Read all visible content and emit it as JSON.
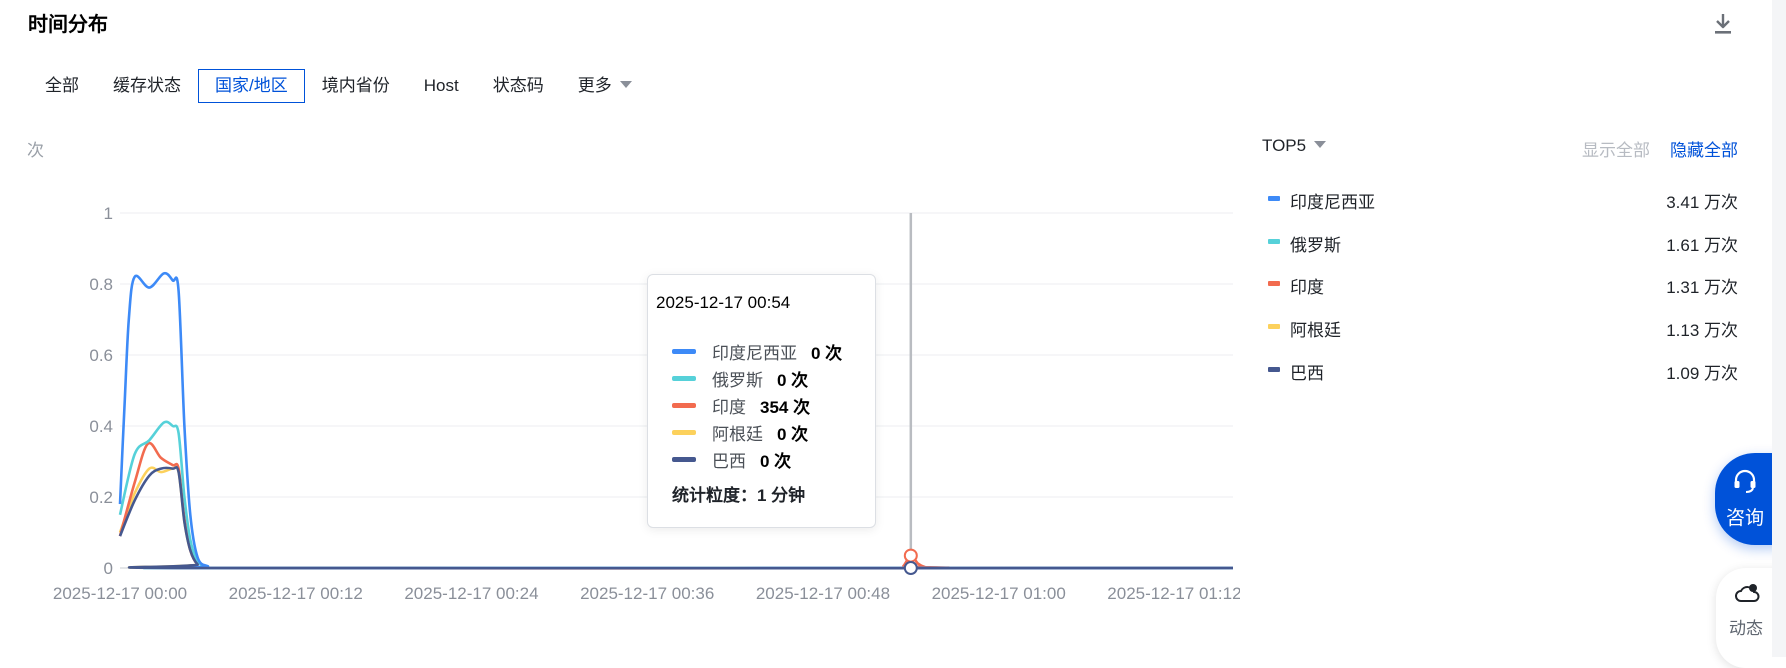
{
  "header": {
    "title": "时间分布",
    "download_icon": "download-icon"
  },
  "tabs": [
    {
      "label": "全部",
      "active": false
    },
    {
      "label": "缓存状态",
      "active": false
    },
    {
      "label": "国家/地区",
      "active": true
    },
    {
      "label": "境内省份",
      "active": false
    },
    {
      "label": "Host",
      "active": false
    },
    {
      "label": "状态码",
      "active": false
    },
    {
      "label": "更多",
      "active": false,
      "dropdown": true
    }
  ],
  "chart_data": {
    "type": "line",
    "ylabel": "次",
    "ylim": [
      0,
      1
    ],
    "yticks": [
      "0",
      "0.2",
      "0.4",
      "0.6",
      "0.8",
      "1"
    ],
    "xlim": [
      0,
      76
    ],
    "xtick_minutes": [
      0,
      12,
      24,
      36,
      48,
      60,
      72
    ],
    "xticks": [
      "2025-12-17 00:00",
      "2025-12-17 00:12",
      "2025-12-17 00:24",
      "2025-12-17 00:36",
      "2025-12-17 00:48",
      "2025-12-17 01:00",
      "2025-12-17 01:12"
    ],
    "grid": true,
    "cursor_minute": 54,
    "series": [
      {
        "name": "印度尼西亚",
        "color": "#3d8af7",
        "points": [
          [
            0,
            0.18
          ],
          [
            0.3,
            0.45
          ],
          [
            0.6,
            0.7
          ],
          [
            1,
            0.82
          ],
          [
            2,
            0.79
          ],
          [
            3,
            0.83
          ],
          [
            3.6,
            0.81
          ],
          [
            4,
            0.78
          ],
          [
            4.4,
            0.4
          ],
          [
            4.8,
            0.15
          ],
          [
            5.3,
            0.03
          ],
          [
            6,
            0.005
          ],
          [
            7,
            0
          ],
          [
            76,
            0
          ]
        ]
      },
      {
        "name": "俄罗斯",
        "color": "#56d1d9",
        "points": [
          [
            0,
            0.15
          ],
          [
            1,
            0.32
          ],
          [
            2,
            0.36
          ],
          [
            3,
            0.41
          ],
          [
            3.6,
            0.4
          ],
          [
            4,
            0.38
          ],
          [
            4.4,
            0.2
          ],
          [
            4.8,
            0.08
          ],
          [
            5.3,
            0.02
          ],
          [
            6,
            0.003
          ],
          [
            7,
            0
          ],
          [
            76,
            0
          ]
        ]
      },
      {
        "name": "印度",
        "color": "#f26b4f",
        "points": [
          [
            0,
            0.09
          ],
          [
            1,
            0.24
          ],
          [
            1.9,
            0.35
          ],
          [
            2.8,
            0.31
          ],
          [
            3.6,
            0.29
          ],
          [
            4,
            0.28
          ],
          [
            4.4,
            0.14
          ],
          [
            4.8,
            0.05
          ],
          [
            5.3,
            0.01
          ],
          [
            6,
            0
          ],
          [
            53,
            0
          ],
          [
            53.5,
            0.006
          ],
          [
            54,
            0.035
          ],
          [
            54.5,
            0.012
          ],
          [
            55,
            0.002
          ],
          [
            55.6,
            0
          ],
          [
            76,
            0
          ]
        ]
      },
      {
        "name": "阿根廷",
        "color": "#fcd15c",
        "points": [
          [
            0,
            0.1
          ],
          [
            1,
            0.21
          ],
          [
            2,
            0.28
          ],
          [
            2.8,
            0.27
          ],
          [
            3.6,
            0.28
          ],
          [
            4,
            0.27
          ],
          [
            4.4,
            0.13
          ],
          [
            4.8,
            0.05
          ],
          [
            5.3,
            0.01
          ],
          [
            6,
            0
          ],
          [
            76,
            0
          ]
        ]
      },
      {
        "name": "巴西",
        "color": "#45588f",
        "points": [
          [
            0,
            0.09
          ],
          [
            1,
            0.19
          ],
          [
            2,
            0.26
          ],
          [
            2.8,
            0.28
          ],
          [
            3.6,
            0.28
          ],
          [
            4,
            0.27
          ],
          [
            4.4,
            0.13
          ],
          [
            4.8,
            0.05
          ],
          [
            5.3,
            0.01
          ],
          [
            6,
            0
          ],
          [
            76,
            0
          ]
        ]
      }
    ]
  },
  "tooltip": {
    "time": "2025-12-17 00:54",
    "rows": [
      {
        "name": "印度尼西亚",
        "value": "0 次",
        "color": "#3d8af7"
      },
      {
        "name": "俄罗斯",
        "value": "0 次",
        "color": "#56d1d9"
      },
      {
        "name": "印度",
        "value": "354 次",
        "color": "#f26b4f"
      },
      {
        "name": "阿根廷",
        "value": "0 次",
        "color": "#fcd15c"
      },
      {
        "name": "巴西",
        "value": "0 次",
        "color": "#45588f"
      }
    ],
    "granularity": "统计粒度：1 分钟"
  },
  "legend": {
    "selector": "TOP5",
    "show_all": "显示全部",
    "hide_all": "隐藏全部",
    "items": [
      {
        "name": "印度尼西亚",
        "value": "3.41 万次",
        "color": "#3d8af7"
      },
      {
        "name": "俄罗斯",
        "value": "1.61 万次",
        "color": "#56d1d9"
      },
      {
        "name": "印度",
        "value": "1.31 万次",
        "color": "#f26b4f"
      },
      {
        "name": "阿根廷",
        "value": "1.13 万次",
        "color": "#fcd15c"
      },
      {
        "name": "巴西",
        "value": "1.09 万次",
        "color": "#45588f"
      }
    ]
  },
  "float_buttons": {
    "consult": {
      "label": "咨询",
      "icon": "headset-icon"
    },
    "dynamic": {
      "label": "动态",
      "icon": "cloud-bell-icon"
    }
  }
}
